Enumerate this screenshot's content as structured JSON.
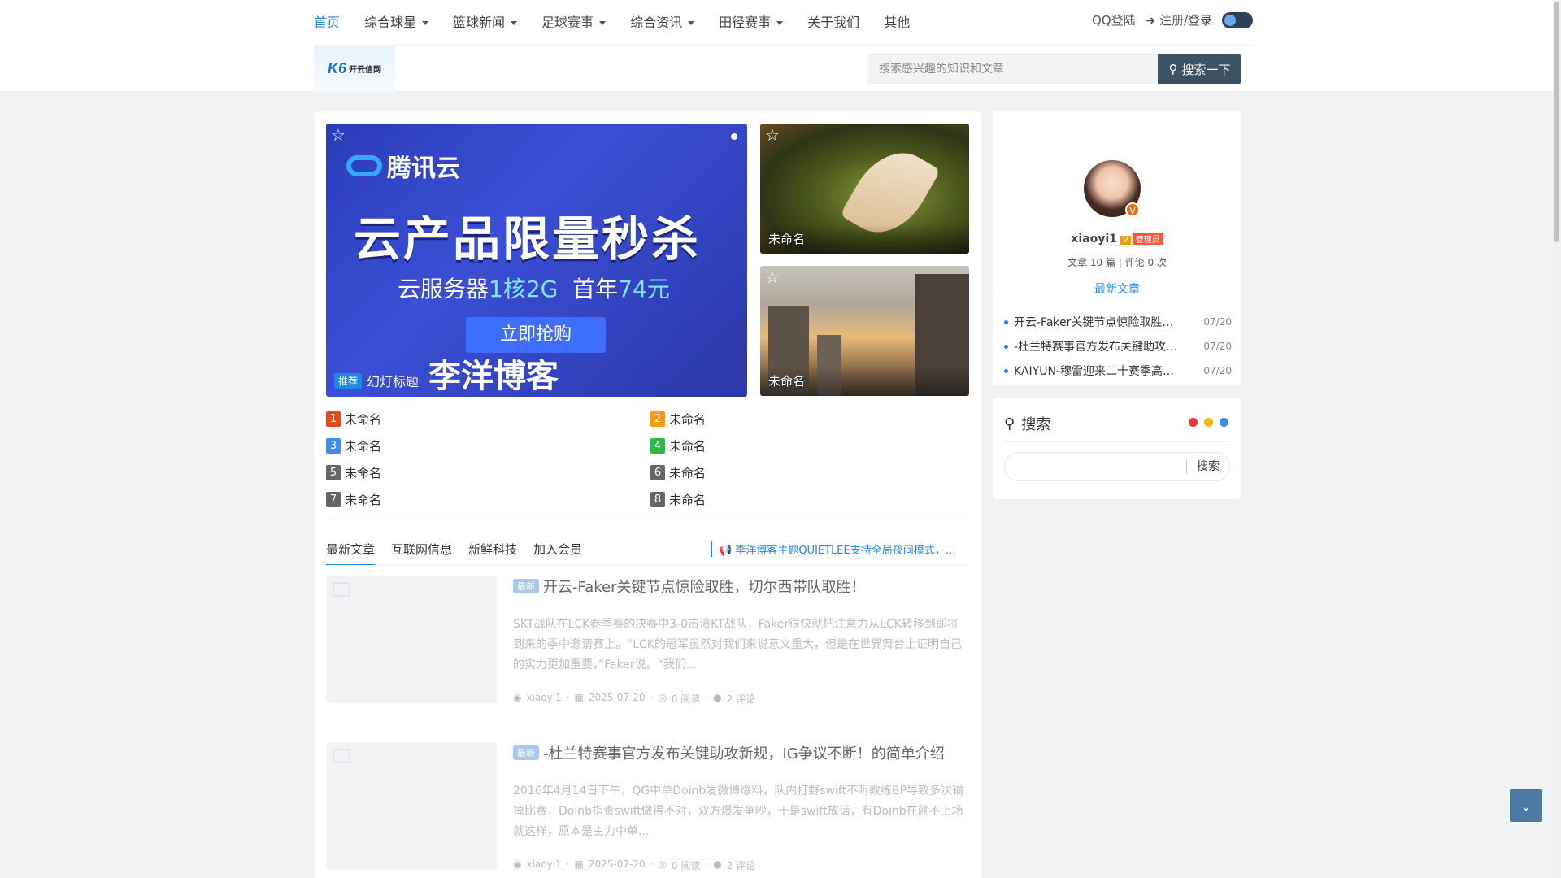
{
  "nav": {
    "items": [
      {
        "label": "首页",
        "dropdown": false
      },
      {
        "label": "综合球星",
        "dropdown": true
      },
      {
        "label": "篮球新闻",
        "dropdown": true
      },
      {
        "label": "足球赛事",
        "dropdown": true
      },
      {
        "label": "综合资讯",
        "dropdown": true
      },
      {
        "label": "田径赛事",
        "dropdown": true
      },
      {
        "label": "关于我们",
        "dropdown": false
      },
      {
        "label": "其他",
        "dropdown": false
      }
    ],
    "qq_login": "QQ登陆",
    "register_login": "注册/登录"
  },
  "logo": {
    "mark": "K6",
    "text": "开云信网"
  },
  "search": {
    "placeholder": "搜索感兴趣的知识和文章",
    "button": "搜索一下"
  },
  "slider": {
    "brand": "腾讯云",
    "headline": "云产品限量秒杀",
    "sub_prefix": "云服务器",
    "sub_highlight_1": "1核2G",
    "sub_mid": "首年",
    "sub_highlight_2": "74元",
    "cta": "立即抢购",
    "site": "李洋博客Talklee.Com",
    "tag": "推荐",
    "caption": "幻灯标题"
  },
  "thumbs": [
    {
      "caption": "未命名"
    },
    {
      "caption": "未命名"
    }
  ],
  "toplist": [
    {
      "num": "1",
      "label": "未命名",
      "color": "#e8461c"
    },
    {
      "num": "2",
      "label": "未命名",
      "color": "#f39c12"
    },
    {
      "num": "3",
      "label": "未命名",
      "color": "#3d8ef0"
    },
    {
      "num": "4",
      "label": "未命名",
      "color": "#2db84d"
    },
    {
      "num": "5",
      "label": "未命名",
      "color": "#666666"
    },
    {
      "num": "6",
      "label": "未命名",
      "color": "#666666"
    },
    {
      "num": "7",
      "label": "未命名",
      "color": "#666666"
    },
    {
      "num": "8",
      "label": "未命名",
      "color": "#666666"
    }
  ],
  "tabs": [
    "最新文章",
    "互联网信息",
    "新鲜科技",
    "加入会员"
  ],
  "notice": "李洋博客主题QUIETLEE支持全局夜间模式，点击右上角开关",
  "posts": [
    {
      "tag": "最新",
      "title": "开云-Faker关键节点惊险取胜，切尔西带队取胜！",
      "desc": "SKT战队在LCK春季赛的决赛中3-0击溃KT战队，Faker很快就把注意力从LCK转移到即将到来的季中邀请赛上。“LCK的冠军虽然对我们来说意义重大，但是在世界舞台上证明自己的实力更加重要，”Faker说。“我们...",
      "author": "xiaoyi1",
      "date": "2025-07-20",
      "reads": "0 阅读",
      "comments": "2 评论"
    },
    {
      "tag": "最新",
      "title": "-杜兰特赛事官方发布关键助攻新规，IG争议不断！的简单介绍",
      "desc": "2016年4月14日下午，QG中单Doinb发微博爆料，队内打野swift不听教练BP导致多次输掉比赛，Doinb指责swift做得不对，双方爆发争吵，于是swift放话，有Doinb在就不上场就这样，原本是主力中单...",
      "author": "xiaoyi1",
      "date": "2025-07-20",
      "reads": "0 阅读",
      "comments": "2 评论"
    }
  ],
  "profile": {
    "name": "xiaoyi1",
    "badge_v": "V",
    "badge_admin": "管理员",
    "stats": "文章 10 篇 | 评论 0 次",
    "latest_heading": "最新文章",
    "latest": [
      {
        "title": "开云-Faker关键节点惊险取胜，切尔西带队取胜！",
        "date": "07/20"
      },
      {
        "title": "-杜兰特赛事官方发布关键助攻新规，IG争议不断！的简单介绍",
        "date": "07/20"
      },
      {
        "title": "KAIYUN-穆雷迎来二十赛季高光表现",
        "date": "07/20"
      }
    ]
  },
  "search_widget": {
    "title": "搜索",
    "button": "搜索",
    "dot_colors": [
      "#f0392b",
      "#f5b800",
      "#3d8ef0"
    ]
  }
}
